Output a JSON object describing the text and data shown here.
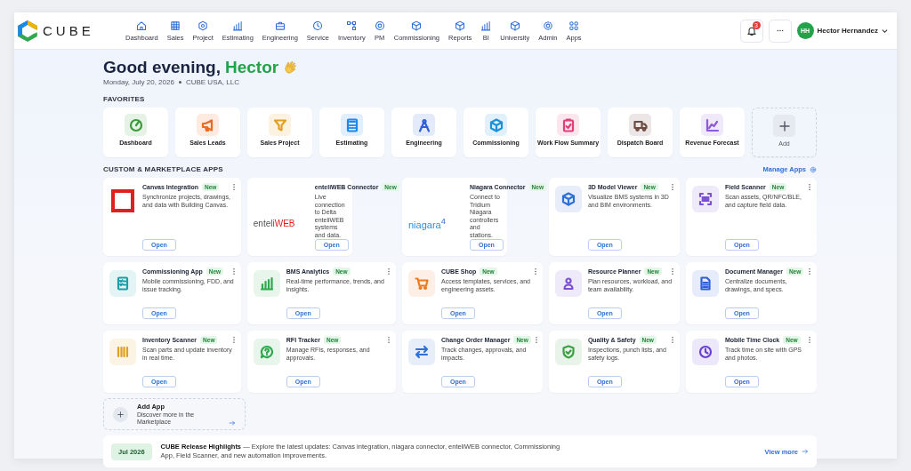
{
  "brand": {
    "name": "CUBE"
  },
  "nav": [
    {
      "label": "Dashboard"
    },
    {
      "label": "Sales"
    },
    {
      "label": "Project"
    },
    {
      "label": "Estimating"
    },
    {
      "label": "Engineering"
    },
    {
      "label": "Service"
    },
    {
      "label": "Inventory"
    },
    {
      "label": "PM"
    },
    {
      "label": "Commissioning"
    },
    {
      "label": "Reports"
    },
    {
      "label": "BI"
    },
    {
      "label": "University"
    },
    {
      "label": "Admin"
    },
    {
      "label": "Apps"
    }
  ],
  "notifications": {
    "badge": "3"
  },
  "user": {
    "initials": "HH",
    "name": "Hector Hernandez"
  },
  "greeting": {
    "text": "Good evening,",
    "name": "Hector"
  },
  "date": "Monday, July 20, 2026",
  "company": "CUBE USA, LLC",
  "favorites": {
    "title": "FAVORITES",
    "items": [
      {
        "kind": "app",
        "label": "Dashboard",
        "color": "#3a9a3a"
      },
      {
        "kind": "app",
        "label": "Sales Leads",
        "color": "#f06a1e"
      },
      {
        "kind": "app",
        "label": "Sales Project",
        "color": "#e0a020"
      },
      {
        "kind": "app",
        "label": "Estimating",
        "color": "#1e88e5"
      },
      {
        "kind": "app",
        "label": "Engineering",
        "color": "#2f5fd0"
      },
      {
        "kind": "app",
        "label": "Commissioning",
        "color": "#1e90d8"
      },
      {
        "kind": "app",
        "label": "Work Flow Summary",
        "color": "#e0407a"
      },
      {
        "kind": "app",
        "label": "Dispatch Board",
        "color": "#6d4c41"
      },
      {
        "kind": "app",
        "label": "Revenue Forecast",
        "color": "#8e5bd8"
      },
      {
        "kind": "add",
        "label": "Add"
      }
    ]
  },
  "apps": {
    "title": "CUSTOM & MARKETPLACE APPS",
    "manage": "Manage Apps",
    "items": [
      {
        "kind": "square",
        "title": "Canvas Integration",
        "badge": "New",
        "description": "Synchronize projects, drawings, and data with Building Canvas.",
        "action": "Open",
        "color": "#e02020"
      },
      {
        "kind": "logo",
        "logo": {
          "text": "enteli",
          "accent": "WEB"
        },
        "title": "enteliWEB Connector",
        "badge": "New",
        "description": "Live connection to Delta enteliWEB systems and data.",
        "action": "Open"
      },
      {
        "kind": "logo",
        "logo": {
          "text": "niagara",
          "sup": "4"
        },
        "title": "Niagara Connector",
        "badge": "New",
        "description": "Connect to Tridium Niagara controllers and stations.",
        "action": "Open"
      },
      {
        "kind": "icon",
        "title": "3D Model Viewer",
        "badge": "New",
        "description": "Visualize BMS systems in 3D and BIM environments.",
        "action": "Open",
        "color": "#2f6fd8"
      },
      {
        "kind": "icon",
        "title": "Field Scanner",
        "badge": "New",
        "description": "Scan assets, QR/NFC/BLE, and capture field data.",
        "action": "Open",
        "color": "#7a4fd0"
      },
      {
        "kind": "icon",
        "title": "Commissioning App",
        "badge": "New",
        "description": "Mobile commissioning, FDD, and issue tracking.",
        "action": "Open",
        "color": "#1a9fa8"
      },
      {
        "kind": "icon",
        "title": "BMS Analytics",
        "badge": "New",
        "description": "Real-time performance, trends, and insights.",
        "action": "Open",
        "color": "#2fa84f"
      },
      {
        "kind": "icon",
        "title": "CUBE Shop",
        "badge": "New",
        "description": "Access templates, services, and engineering assets.",
        "action": "Open",
        "color": "#f07a1e"
      },
      {
        "kind": "icon",
        "title": "Resource Planner",
        "badge": "New",
        "description": "Plan resources, workload, and team availability.",
        "action": "Open",
        "color": "#7a4fd0"
      },
      {
        "kind": "icon",
        "title": "Document Manager",
        "badge": "New",
        "description": "Centralize documents, drawings, and specs.",
        "action": "Open",
        "color": "#2f5fd8"
      },
      {
        "kind": "icon",
        "title": "Inventory Scanner",
        "badge": "New",
        "description": "Scan parts and update inventory in real time.",
        "action": "Open",
        "color": "#e0a020"
      },
      {
        "kind": "icon",
        "title": "RFI Tracker",
        "badge": "New",
        "description": "Manage RFIs, responses, and approvals.",
        "action": "Open",
        "color": "#2fa84f"
      },
      {
        "kind": "icon",
        "title": "Change Order Manager",
        "badge": "New",
        "description": "Track changes, approvals, and impacts.",
        "action": "Open",
        "color": "#2f6fd8"
      },
      {
        "kind": "icon",
        "title": "Quality & Safety",
        "badge": "New",
        "description": "Inspections, punch lists, and safety logs.",
        "action": "Open",
        "color": "#3aa040"
      },
      {
        "kind": "icon",
        "title": "Mobile Time Clock",
        "badge": "New",
        "description": "Track time on site with GPS and photos.",
        "action": "Open",
        "color": "#6a3fd0"
      }
    ],
    "add": {
      "title": "Add App",
      "description": "Discover more in the Marketplace"
    }
  },
  "banner": {
    "tag": "Jul 2026",
    "text": "**CUBE  Release Highlights** — Explore the latest updates: Canvas integration, niagara connector, enteliWEB connector, Commissioning App, Field Scanner, and new automation improvements.",
    "link": "View more"
  }
}
